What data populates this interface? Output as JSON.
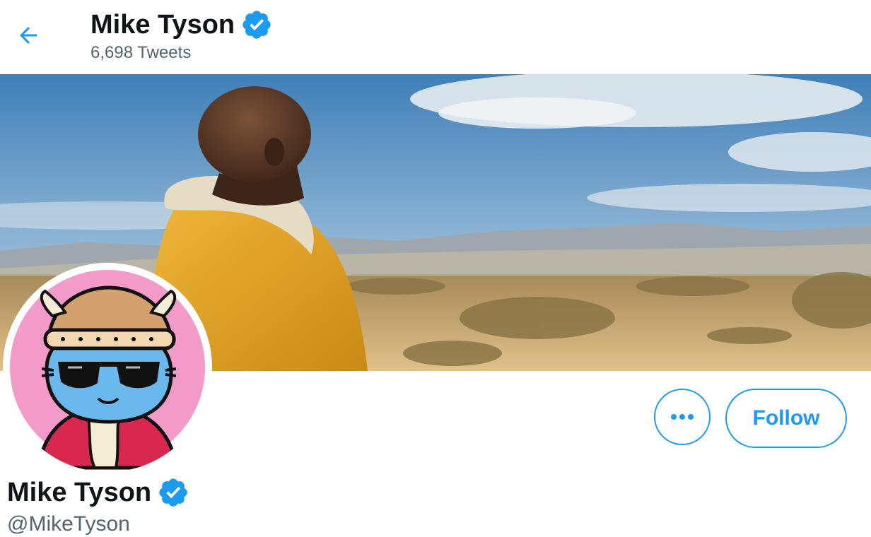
{
  "header": {
    "name": "Mike Tyson",
    "tweet_count": "6,698 Tweets"
  },
  "profile": {
    "name": "Mike Tyson",
    "handle": "@MikeTyson",
    "verified": true
  },
  "actions": {
    "more_icon": "more-dots-icon",
    "follow_label": "Follow"
  },
  "icons": {
    "back": "back-arrow-icon",
    "verified": "verified-badge-icon"
  },
  "colors": {
    "accent": "#1d9bf0",
    "text_primary": "#0f1419",
    "text_secondary": "#536471",
    "avatar_bg": "#f29bc8",
    "jacket": "#e0a526"
  }
}
